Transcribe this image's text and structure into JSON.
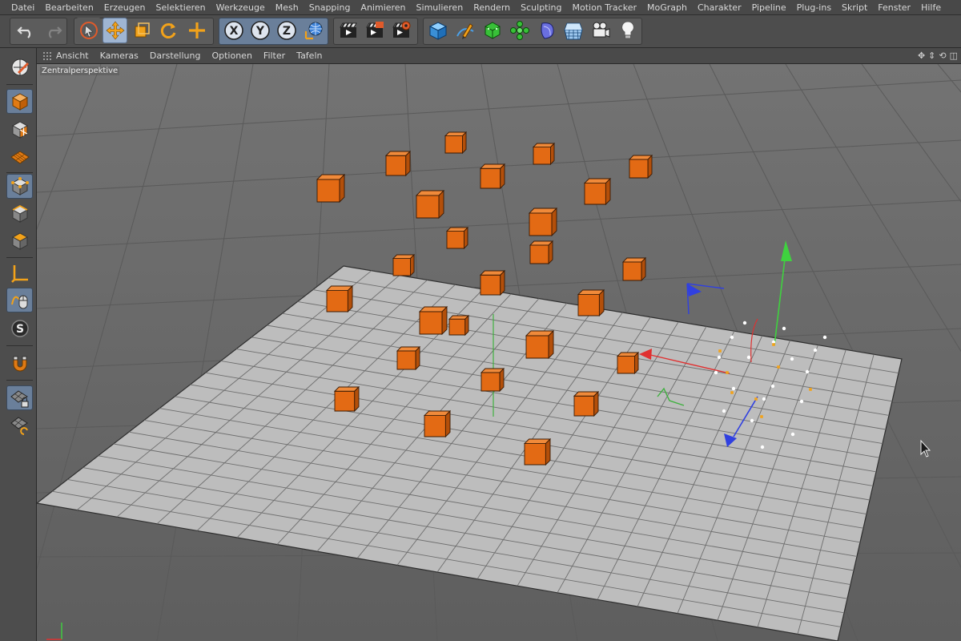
{
  "menu": [
    "Datei",
    "Bearbeiten",
    "Erzeugen",
    "Selektieren",
    "Werkzeuge",
    "Mesh",
    "Snapping",
    "Animieren",
    "Simulieren",
    "Rendern",
    "Sculpting",
    "Motion Tracker",
    "MoGraph",
    "Charakter",
    "Pipeline",
    "Plug-ins",
    "Skript",
    "Fenster",
    "Hilfe"
  ],
  "toolbar": {
    "axis_x": "X",
    "axis_y": "Y",
    "axis_z": "Z"
  },
  "left_toolbar": {
    "s_label": "S"
  },
  "viewport": {
    "menu": [
      "Ansicht",
      "Kameras",
      "Darstellung",
      "Optionen",
      "Filter",
      "Tafeln"
    ],
    "nav_icons": [
      "✥",
      "⇕",
      "⟲",
      "◫"
    ],
    "camera_label": "Zentralperspektive"
  },
  "colors": {
    "accent": "#6a7f9a",
    "cube": "#e36a14",
    "x_axis": "#e03030",
    "y_axis": "#3fd23f",
    "z_axis": "#3040e0"
  },
  "icons": [
    "undo-icon",
    "redo-icon",
    "select-live-icon",
    "move-icon",
    "scale-icon",
    "rotate-icon",
    "add-object-icon",
    "world-coordinates-icon",
    "render-view-icon",
    "render-picture-icon",
    "render-settings-icon",
    "cube-primitive-icon",
    "pen-spline-icon",
    "subdivision-icon",
    "mograph-cloner-icon",
    "deformer-icon",
    "floor-icon",
    "camera-icon",
    "light-icon"
  ]
}
